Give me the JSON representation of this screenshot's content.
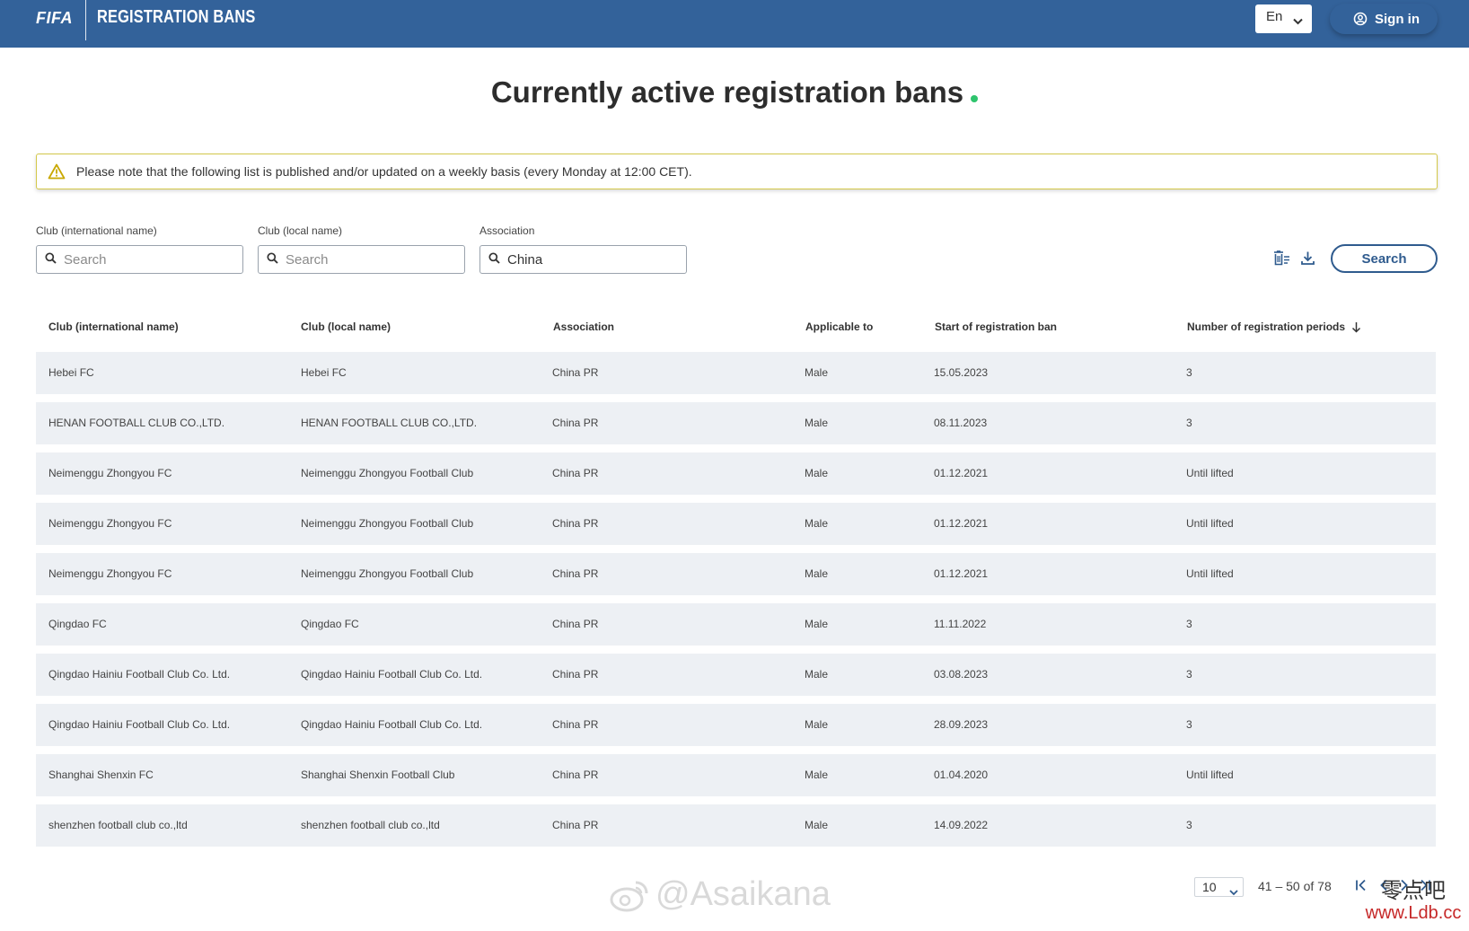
{
  "header": {
    "logo": "FIFA",
    "app_title": "REGISTRATION BANS",
    "language": "En",
    "signin_label": "Sign in"
  },
  "page": {
    "title": "Currently active registration bans"
  },
  "notice": {
    "text": "Please note that the following list is published and/or updated on a weekly basis (every Monday at 12:00 CET)."
  },
  "filters": {
    "club_international": {
      "label": "Club (international name)",
      "value": "",
      "placeholder": "Search"
    },
    "club_local": {
      "label": "Club (local name)",
      "value": "",
      "placeholder": "Search"
    },
    "association": {
      "label": "Association",
      "value": "China",
      "placeholder": "Search"
    },
    "search_button": "Search"
  },
  "table": {
    "columns": [
      "Club (international name)",
      "Club (local name)",
      "Association",
      "Applicable to",
      "Start of registration ban",
      "Number of registration periods"
    ],
    "sorted_column": "Number of registration periods",
    "sort_direction": "descending",
    "rows": [
      [
        "Hebei FC",
        "Hebei FC",
        "China PR",
        "Male",
        "15.05.2023",
        "3"
      ],
      [
        "HENAN FOOTBALL CLUB CO.,LTD.",
        "HENAN FOOTBALL CLUB CO.,LTD.",
        "China PR",
        "Male",
        "08.11.2023",
        "3"
      ],
      [
        "Neimenggu Zhongyou FC",
        "Neimenggu Zhongyou Football Club",
        "China PR",
        "Male",
        "01.12.2021",
        "Until lifted"
      ],
      [
        "Neimenggu Zhongyou FC",
        "Neimenggu Zhongyou Football Club",
        "China PR",
        "Male",
        "01.12.2021",
        "Until lifted"
      ],
      [
        "Neimenggu Zhongyou FC",
        "Neimenggu Zhongyou Football Club",
        "China PR",
        "Male",
        "01.12.2021",
        "Until lifted"
      ],
      [
        "Qingdao FC",
        "Qingdao FC",
        "China PR",
        "Male",
        "11.11.2022",
        "3"
      ],
      [
        "Qingdao Hainiu Football Club Co. Ltd.",
        "Qingdao Hainiu Football Club Co. Ltd.",
        "China PR",
        "Male",
        "03.08.2023",
        "3"
      ],
      [
        "Qingdao Hainiu Football Club Co. Ltd.",
        "Qingdao Hainiu Football Club Co. Ltd.",
        "China PR",
        "Male",
        "28.09.2023",
        "3"
      ],
      [
        "Shanghai Shenxin FC",
        "Shanghai Shenxin Football Club",
        "China PR",
        "Male",
        "01.04.2020",
        "Until lifted"
      ],
      [
        "shenzhen football club co.,ltd",
        "shenzhen football club co.,ltd",
        "China PR",
        "Male",
        "14.09.2022",
        "3"
      ]
    ]
  },
  "pagination": {
    "page_size": "10",
    "range": "41 – 50 of 78"
  },
  "watermarks": {
    "center": "@Asaikana",
    "corner_cn": "零点吧",
    "corner_url": "www.Ldb.cc"
  },
  "colors": {
    "header_bg": "#33629a",
    "row_bg": "#edf0f4",
    "accent_border": "#2f5b8e",
    "notice_border": "#d4c84a",
    "live_dot": "#2ec46d"
  }
}
